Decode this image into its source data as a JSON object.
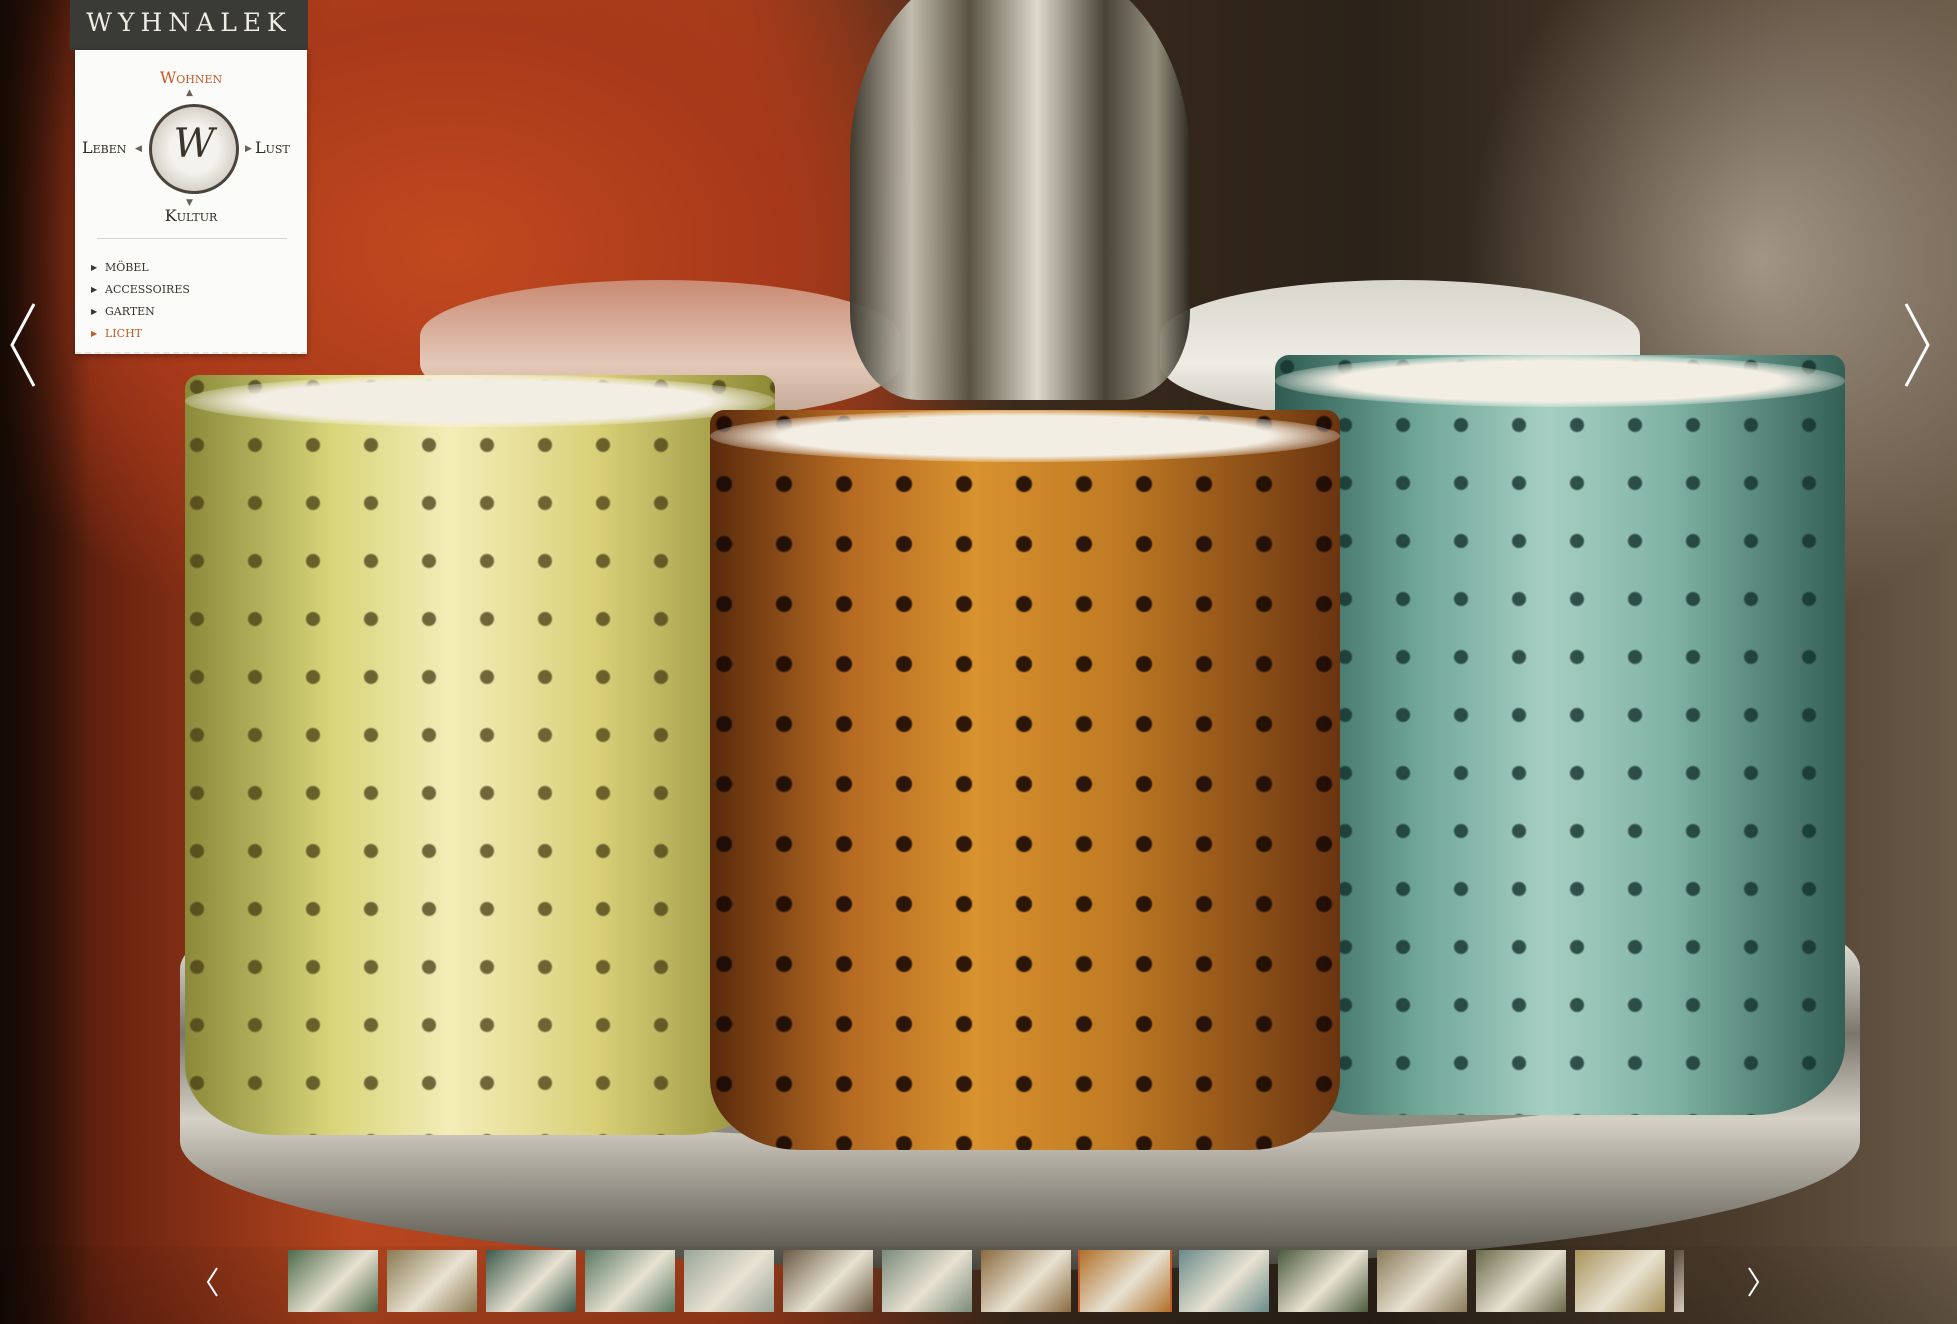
{
  "brand": {
    "name": "WYHNALEK",
    "seal": {
      "top": "Wohnen",
      "left": "Leben",
      "right": "Lust",
      "bottom": "Kultur",
      "monogram": "W"
    }
  },
  "menu": {
    "items": [
      {
        "label": "MÖBEL",
        "active": false
      },
      {
        "label": "ACCESSOIRES",
        "active": false
      },
      {
        "label": "GARTEN",
        "active": false
      },
      {
        "label": "LICHT",
        "active": true
      }
    ]
  },
  "colors": {
    "accent": "#c45a28",
    "panel": "#fbfbf9",
    "header_tab": "#3a3a36"
  },
  "slideshow": {
    "current_photo": "hobnail glass candle holders on silver tray",
    "prev_icon": "chevron-left-icon",
    "next_icon": "chevron-right-icon"
  },
  "thumbnails": [
    {
      "subject": "shop interior",
      "color": "#4d6a4a"
    },
    {
      "subject": "silver jars",
      "color": "#8a7a52"
    },
    {
      "subject": "lanterns",
      "color": "#3c5a4c"
    },
    {
      "subject": "green vases",
      "color": "#5a7a64"
    },
    {
      "subject": "bowls",
      "color": "#9aa69a"
    },
    {
      "subject": "pendant lamps",
      "color": "#6a5a44"
    },
    {
      "subject": "tableware",
      "color": "#7a8a7a"
    },
    {
      "subject": "copper lamp",
      "color": "#8a6a40"
    },
    {
      "subject": "candle holders",
      "color": "#b0702a",
      "selected": true
    },
    {
      "subject": "table lamp",
      "color": "#6a8a8a"
    },
    {
      "subject": "lamp display",
      "color": "#4a5a3c"
    },
    {
      "subject": "lamp shades",
      "color": "#8a7a5a"
    },
    {
      "subject": "bottles",
      "color": "#6a6a4a"
    },
    {
      "subject": "gold jars",
      "color": "#a8945a"
    },
    {
      "subject": "shelf",
      "color": "#5a4a3a"
    }
  ]
}
